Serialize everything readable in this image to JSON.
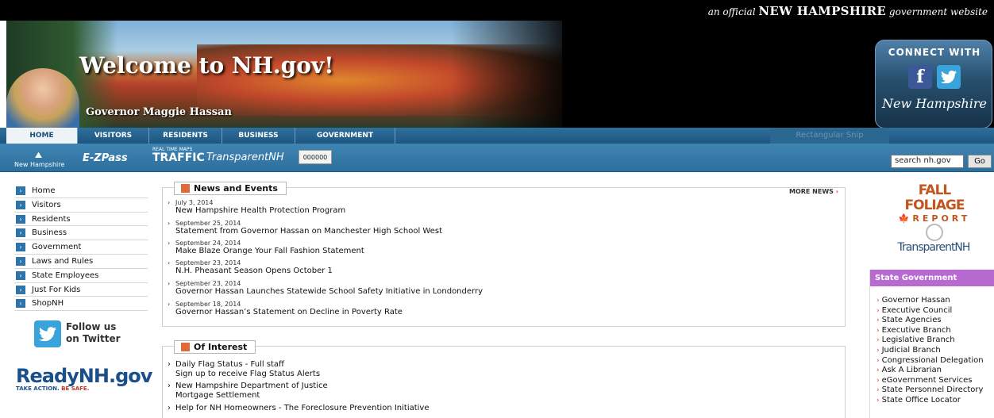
{
  "header": {
    "official_pre": "an official",
    "official_state": "NEW HAMPSHIRE",
    "official_post": "government website"
  },
  "banner": {
    "welcome": "Welcome to NH.gov!",
    "governor": "Governor Maggie Hassan",
    "connect_title": "CONNECT WITH",
    "connect_fb": "f",
    "connect_nh": "New Hampshire"
  },
  "nav": {
    "tabs": [
      "HOME",
      "VISITORS",
      "RESIDENTS",
      "BUSINESS",
      "GOVERNMENT"
    ],
    "overlay_text": "Rectangular Snip"
  },
  "quicklinks": {
    "nh_logo": "New Hampshire",
    "ezpass": "E-ZPass",
    "traffic_small": "REAL TIME MAPS",
    "traffic": "TRAFFIC",
    "transparent": "TransparentNH",
    "plate": "000000"
  },
  "search": {
    "value": "search nh.gov",
    "go": "Go"
  },
  "left_nav": {
    "items": [
      "Home",
      "Visitors",
      "Residents",
      "Business",
      "Government",
      "Laws and Rules",
      "State Employees",
      "Just For Kids",
      "ShopNH"
    ]
  },
  "twitter": {
    "line1": "Follow us",
    "line2": "on Twitter"
  },
  "readynh": {
    "logo": "ReadyNH.gov",
    "take_action": "TAKE ACTION.",
    "be_safe": "BE SAFE."
  },
  "news": {
    "title": "News and Events",
    "more": "MORE NEWS",
    "items": [
      {
        "date": "July 3, 2014",
        "title": "New Hampshire Health Protection Program"
      },
      {
        "date": "September 25, 2014",
        "title": "Statement from Governor Hassan on Manchester High School West"
      },
      {
        "date": "September 24, 2014",
        "title": "Make Blaze Orange Your Fall Fashion Statement"
      },
      {
        "date": "September 23, 2014",
        "title": "N.H. Pheasant Season Opens October 1"
      },
      {
        "date": "September 23, 2014",
        "title": "Governor Hassan Launches Statewide School Safety Initiative in Londonderry"
      },
      {
        "date": "September 18, 2014",
        "title": "Governor Hassan’s Statement on Decline in Poverty Rate"
      }
    ]
  },
  "interest": {
    "title": "Of Interest",
    "items": [
      {
        "line1": "Daily Flag Status - Full staff",
        "line2": "Sign up to receive Flag Status Alerts"
      },
      {
        "line1": "New Hampshire Department of Justice",
        "line2": "Mortgage Settlement"
      },
      {
        "line1": "Help for NH Homeowners - The Foreclosure Prevention Initiative",
        "line2": ""
      }
    ]
  },
  "right": {
    "foliage_line1": "FALL FOLIAGE",
    "foliage_line2": "REPORT",
    "transparent": "TransparentNH",
    "state_gov_title": "State Government",
    "state_gov_links": [
      "Governor Hassan",
      "Executive Council",
      "State Agencies",
      "Executive Branch",
      "Legislative Branch",
      "Judicial Branch",
      "Congressional Delegation",
      "Ask A Librarian",
      "eGovernment Services",
      "State Personnel Directory",
      "State Office Locator"
    ]
  },
  "colors": {
    "nav_blue": "#1d5680",
    "accent_orange": "#e06a3a",
    "state_gov_purple": "#b76bd0"
  }
}
